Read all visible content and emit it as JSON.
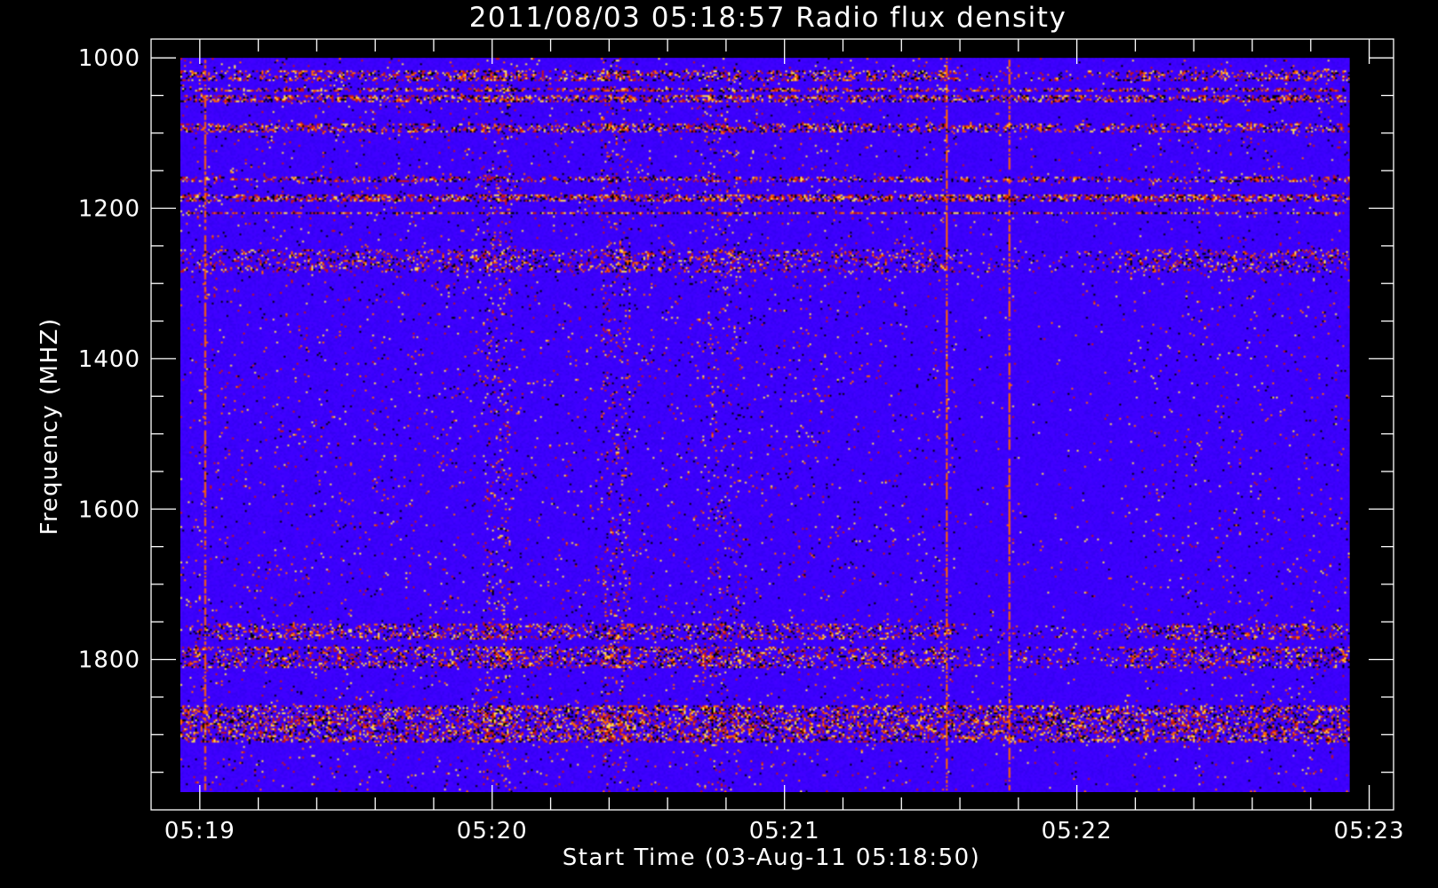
{
  "chart_data": {
    "type": "heatmap",
    "title": "2011/08/03 05:18:57 Radio flux density",
    "xlabel": "Start Time (03-Aug-11 05:18:50)",
    "ylabel": "Frequency (MHZ)",
    "x_range": [
      "05:18:50",
      "05:23:05"
    ],
    "y_range": [
      975,
      2000
    ],
    "y_reversed": true,
    "x_ticks": [
      "05:19",
      "05:20",
      "05:21",
      "05:22",
      "05:23"
    ],
    "x_tick_seconds": [
      10,
      70,
      130,
      190,
      250
    ],
    "x_minor_step_seconds": 12,
    "y_ticks": [
      1000,
      1200,
      1400,
      1600,
      1800
    ],
    "y_tick_labels": [
      "1000",
      "1200",
      "1400",
      "1600",
      "1800"
    ],
    "y_minor_step": 50,
    "data_time_range_seconds": [
      6,
      246
    ],
    "data_freq_range_mhz": [
      1000,
      2000
    ],
    "colormap": [
      "#000000",
      "#3c00ff",
      "#c81414",
      "#ff6400",
      "#ffdc50"
    ],
    "background_color": "#3c00ff",
    "bright_bands_mhz": [
      {
        "range": [
          1015,
          1030
        ],
        "intensity": 0.55
      },
      {
        "range": [
          1040,
          1045
        ],
        "intensity": 0.7
      },
      {
        "range": [
          1050,
          1060
        ],
        "intensity": 0.75
      },
      {
        "range": [
          1088,
          1100
        ],
        "intensity": 0.6
      },
      {
        "range": [
          1160,
          1168
        ],
        "intensity": 0.6
      },
      {
        "range": [
          1185,
          1195
        ],
        "intensity": 0.85
      },
      {
        "range": [
          1209,
          1212
        ],
        "intensity": 0.95
      },
      {
        "range": [
          1260,
          1290
        ],
        "intensity": 0.35
      },
      {
        "range": [
          1770,
          1790
        ],
        "intensity": 0.45
      },
      {
        "range": [
          1800,
          1830
        ],
        "intensity": 0.5
      },
      {
        "range": [
          1880,
          1930
        ],
        "intensity": 0.6
      }
    ],
    "bright_columns_seconds": [
      {
        "t": 71,
        "width": 3,
        "intensity": 0.5
      },
      {
        "t": 95,
        "width": 3,
        "intensity": 0.5
      },
      {
        "t": 117,
        "width": 4,
        "intensity": 0.35
      }
    ],
    "vertical_lines_seconds": [
      11,
      163,
      176
    ]
  }
}
